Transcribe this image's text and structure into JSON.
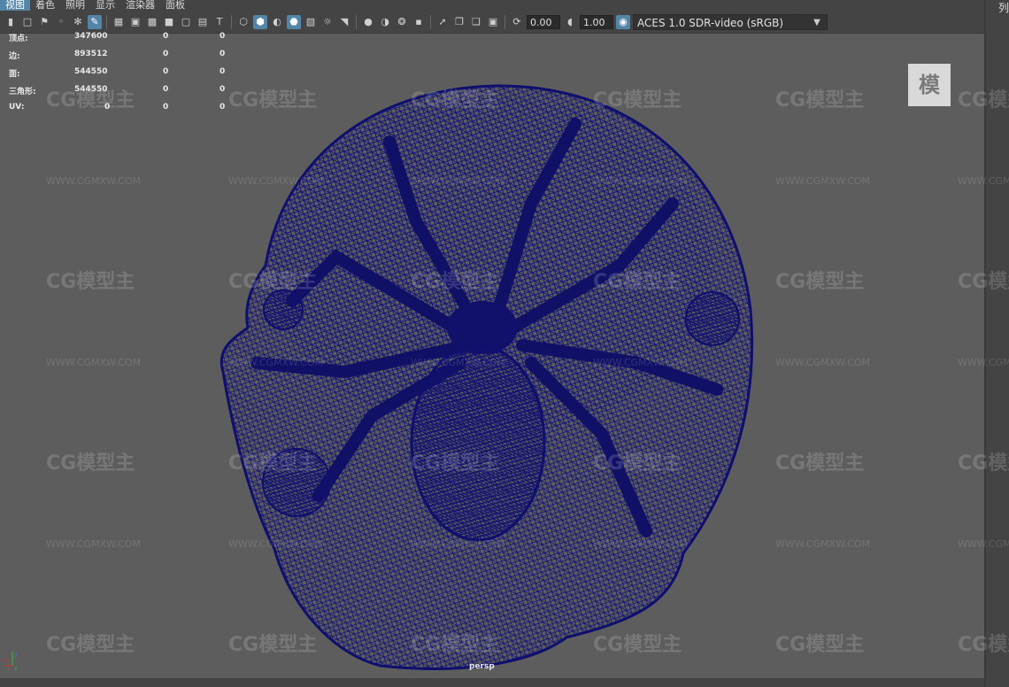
{
  "menu": {
    "items": [
      "视图",
      "着色",
      "照明",
      "显示",
      "渲染器",
      "面板"
    ],
    "active_index": 0
  },
  "toolbar": {
    "exposure_value": "0.00",
    "gamma_value": "1.00",
    "color_space": "ACES 1.0 SDR-video (sRGB)"
  },
  "hud": {
    "rows": [
      {
        "label": "顶点:",
        "v1": "347600",
        "v2": "0",
        "v3": "0"
      },
      {
        "label": "边:",
        "v1": "893512",
        "v2": "0",
        "v3": "0"
      },
      {
        "label": "面:",
        "v1": "544550",
        "v2": "0",
        "v3": "0"
      },
      {
        "label": "三角形:",
        "v1": "544550",
        "v2": "0",
        "v3": "0"
      },
      {
        "label": "UV:",
        "v1": "0",
        "v2": "0",
        "v3": "0"
      }
    ]
  },
  "viewport": {
    "camera_label": "persp",
    "wireframe_color": "#0f0f6e",
    "background": "#5d5d5d"
  },
  "right_panel": {
    "label": "列"
  },
  "watermark": {
    "brand": "CG模型主",
    "url": "WWW.CGMXW.COM",
    "corner_logo": "模"
  },
  "axis": {
    "x": "x",
    "y": "y",
    "z": "z"
  }
}
